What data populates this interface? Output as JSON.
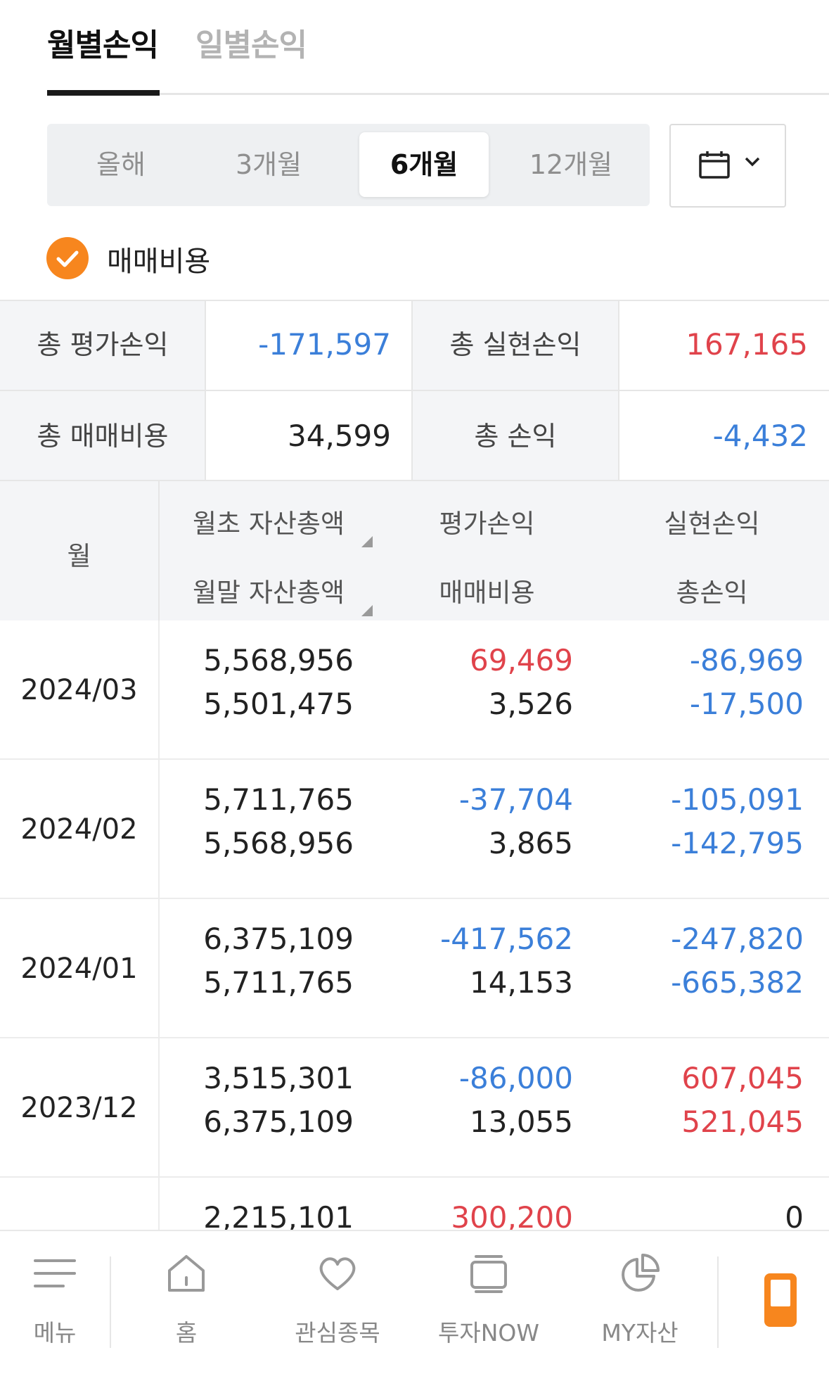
{
  "tabs": {
    "active": "월별손익",
    "inactive": "일별손익"
  },
  "period": {
    "options": [
      "올해",
      "3개월",
      "6개월",
      "12개월"
    ],
    "selected": "6개월"
  },
  "fee_toggle": {
    "label": "매매비용",
    "checked": true
  },
  "summary": {
    "eval_label": "총 평가손익",
    "eval_value": "-171,597",
    "realized_label": "총 실현손익",
    "realized_value": "167,165",
    "fee_label": "총 매매비용",
    "fee_value": "34,599",
    "total_label": "총 손익",
    "total_value": "-4,432"
  },
  "table": {
    "headers": {
      "month": "월",
      "start_assets": "월초 자산총액",
      "end_assets": "월말 자산총액",
      "eval_pl": "평가손익",
      "fees": "매매비용",
      "realized_pl": "실현손익",
      "total_pl": "총손익"
    },
    "rows": [
      {
        "month": "2024/03",
        "start": "5,568,956",
        "end": "5,501,475",
        "eval": "69,469",
        "fee": "3,526",
        "realized": "-86,969",
        "total": "-17,500"
      },
      {
        "month": "2024/02",
        "start": "5,711,765",
        "end": "5,568,956",
        "eval": "-37,704",
        "fee": "3,865",
        "realized": "-105,091",
        "total": "-142,795"
      },
      {
        "month": "2024/01",
        "start": "6,375,109",
        "end": "5,711,765",
        "eval": "-417,562",
        "fee": "14,153",
        "realized": "-247,820",
        "total": "-665,382"
      },
      {
        "month": "2023/12",
        "start": "3,515,301",
        "end": "6,375,109",
        "eval": "-86,000",
        "fee": "13,055",
        "realized": "607,045",
        "total": "521,045"
      },
      {
        "month": "",
        "start": "2,215,101",
        "end": "",
        "eval": "300,200",
        "fee": "",
        "realized": "0",
        "total": ""
      }
    ]
  },
  "nav": [
    "메뉴",
    "홈",
    "관심종목",
    "투자NOW",
    "MY자산"
  ],
  "colors": {
    "accent": "#f7861e",
    "positive": "#e0434b",
    "negative": "#3b7fd9"
  }
}
